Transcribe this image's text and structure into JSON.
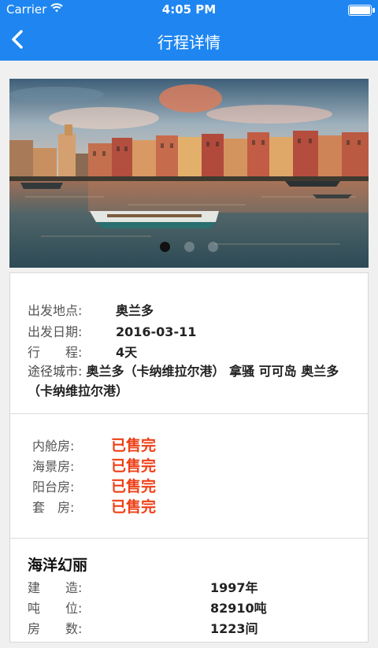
{
  "status": {
    "carrier": "Carrier",
    "time": "4:05 PM"
  },
  "nav": {
    "title": "行程详情"
  },
  "banner": {
    "slides": 3,
    "active_slide": 1
  },
  "trip": {
    "departure_label": "出发地点:",
    "departure_value": "奥兰多",
    "date_label": "出发日期:",
    "date_value": "2016-03-11",
    "duration_label": "行　　程:",
    "duration_value": "4天",
    "route_label": "途径城市:",
    "route_value": "奥兰多（卡纳维拉尔港） 拿骚 可可岛 奥兰多（卡纳维拉尔港）"
  },
  "cabins": [
    {
      "label": "内舱房:",
      "status": "已售完"
    },
    {
      "label": "海景房:",
      "status": "已售完"
    },
    {
      "label": "阳台房:",
      "status": "已售完"
    },
    {
      "label": "套　房:",
      "status": "已售完"
    }
  ],
  "ship": {
    "name": "海洋幻丽",
    "specs": [
      {
        "label": "建　　造:",
        "value": "1997年"
      },
      {
        "label": "吨　　位:",
        "value": "82910吨"
      },
      {
        "label": "房　　数:",
        "value": "1223间"
      }
    ]
  },
  "colors": {
    "primary": "#1f86f1",
    "sold_out": "#ee3f16"
  }
}
